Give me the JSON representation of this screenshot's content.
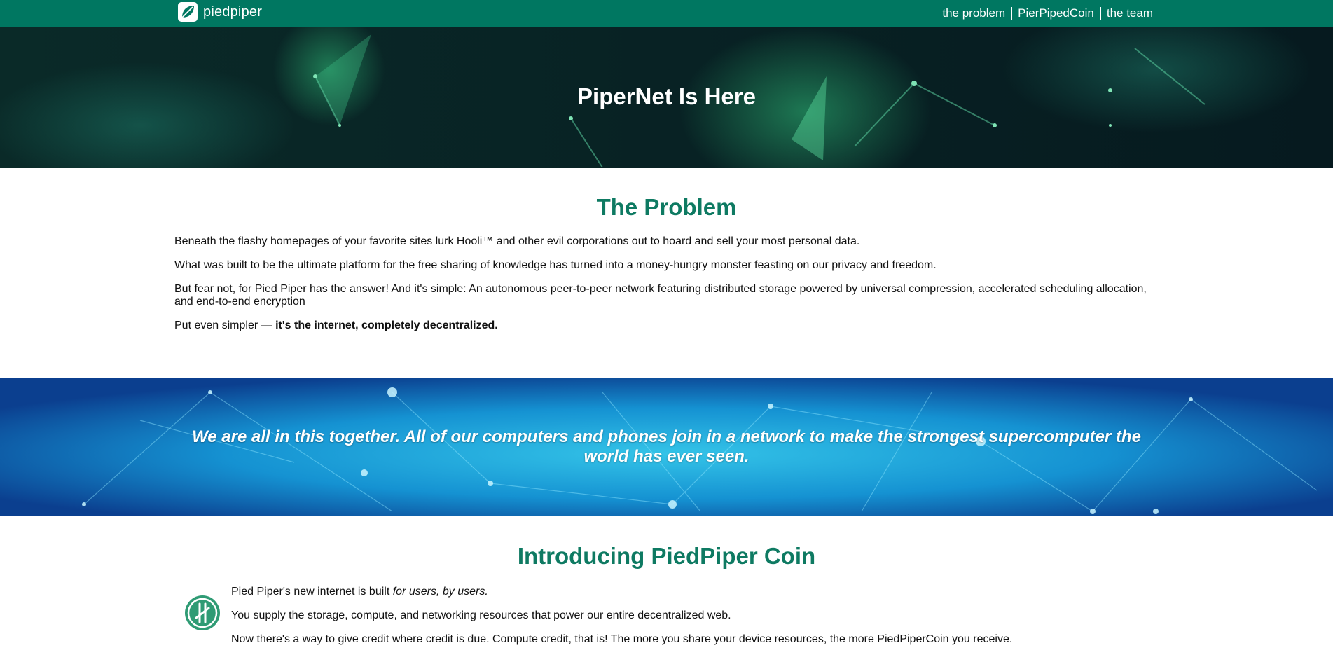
{
  "navbar": {
    "brand_text": "piedpiper",
    "links": [
      "the problem",
      "PierPipedCoin",
      "the team"
    ]
  },
  "hero": {
    "title": "PiperNet Is Here"
  },
  "problem": {
    "title": "The Problem",
    "paragraphs": [
      "Beneath the flashy homepages of your favorite sites lurk Hooli™ and other evil corporations out to hoard and sell your most personal data.",
      "What was built to be the ultimate platform for the free sharing of knowledge has turned into a money-hungry monster feasting on our privacy and freedom.",
      "But fear not, for Pied Piper has the answer! And it's simple: An autonomous peer-to-peer network featuring distributed storage powered by universal compression, accelerated scheduling allocation, and end-to-end encryption"
    ],
    "simpler_prefix": "Put even simpler — ",
    "simpler_bold": "it's the internet, completely decentralized."
  },
  "band": {
    "quote": "We are all in this together. All of our computers and phones join in a network to make the strongest supercomputer the world has ever seen."
  },
  "coin": {
    "title": "Introducing PiedPiper Coin",
    "p1_prefix": "Pied Piper's new internet is built ",
    "p1_italic": "for users, by users.",
    "p2": "You supply the storage, compute, and networking resources that power our entire decentralized web.",
    "p3": "Now there's a way to give credit where credit is due. Compute credit, that is! The more you share your device resources, the more PiedPiperCoin you receive."
  },
  "colors": {
    "nav_bg": "#007761",
    "heading_green": "#0e7a62",
    "hero_bg": "#061a1d",
    "band_bg": "#0a3a8a"
  },
  "icons": {
    "brand": "piedpiper-leaf-logo-icon",
    "coin": "piedpiper-coin-icon"
  }
}
